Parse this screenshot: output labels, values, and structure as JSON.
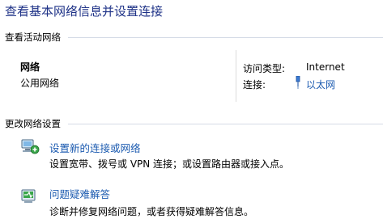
{
  "header": {
    "title": "查看基本网络信息并设置连接"
  },
  "active_networks": {
    "heading": "查看活动网络",
    "network_name": "网络",
    "network_category": "公用网络",
    "access_type_label": "访问类型:",
    "access_type_value": "Internet",
    "connections_label": "连接:",
    "connection_link": "以太网"
  },
  "change_settings": {
    "heading": "更改网络设置",
    "tasks": [
      {
        "label": "设置新的连接或网络",
        "desc": "设置宽带、拨号或 VPN 连接；或设置路由器或接入点。",
        "icon": "network-setup-icon"
      },
      {
        "label": "问题疑难解答",
        "desc": "诊断并修复网络问题，或者获得疑难解答信息。",
        "icon": "troubleshoot-icon"
      }
    ]
  },
  "colors": {
    "link": "#1c5bb0",
    "title": "#1e3287"
  }
}
